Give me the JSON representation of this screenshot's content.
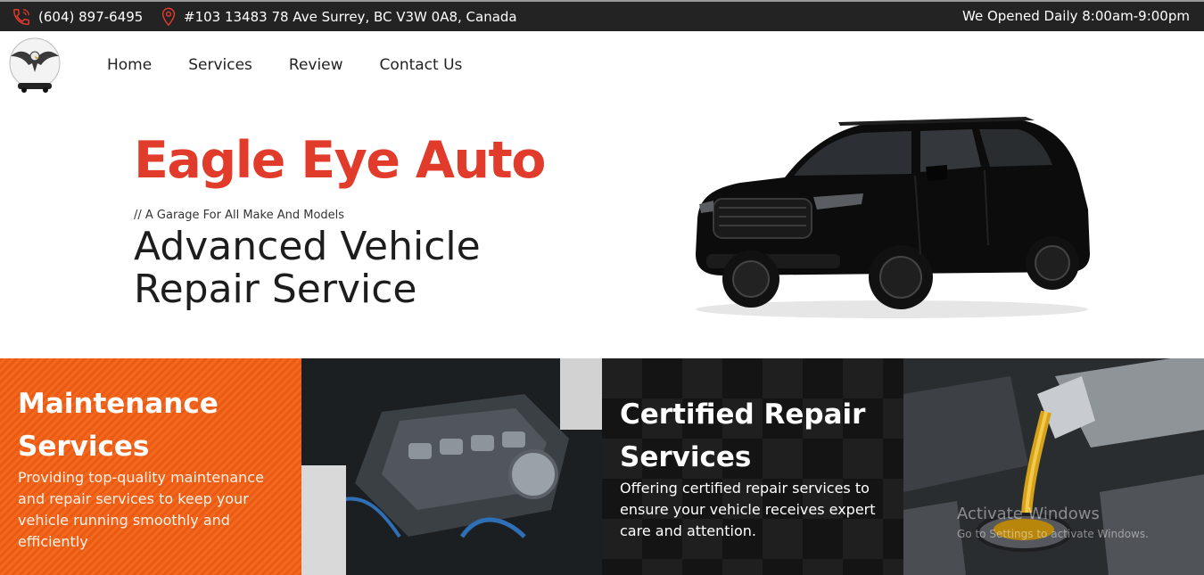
{
  "topbar": {
    "phone": "(604) 897-6495",
    "address": "#103 13483 78 Ave Surrey, BC V3W 0A8, Canada",
    "hours": "We Opened Daily 8:00am-9:00pm",
    "phone_icon": "phone-icon",
    "location_icon": "map-pin-icon",
    "accent_color": "#e13b2c"
  },
  "nav": {
    "items": [
      "Home",
      "Services",
      "Review",
      "Contact Us"
    ]
  },
  "hero": {
    "title": "Eagle Eye Auto",
    "tagline": "// A Garage For All Make And Models",
    "subtitle": "Advanced Vehicle Repair Service"
  },
  "panels": {
    "maintenance": {
      "title": "Maintenance Services",
      "text": "Providing top-quality maintenance and repair services to keep your vehicle running smoothly and efficiently"
    },
    "certified": {
      "title": "Certified Repair Services",
      "text": "Offering certified repair services to ensure your vehicle receives expert care and attention."
    }
  },
  "watermark": {
    "line1": "Activate Windows",
    "line2": "Go to Settings to activate Windows."
  }
}
